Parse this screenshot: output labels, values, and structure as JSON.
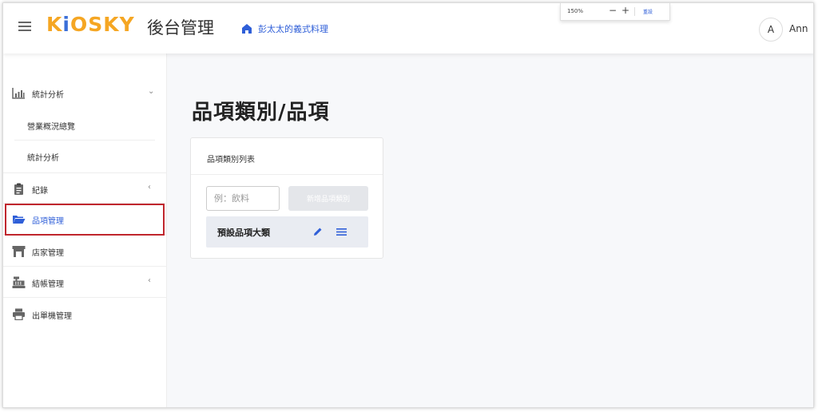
{
  "header": {
    "logo": {
      "part1": "K",
      "dot": "i",
      "part2": "OSKY"
    },
    "title": "後台管理",
    "store_name": "彭太太的義式料理",
    "zoom": {
      "level": "150%",
      "minus": "−",
      "plus": "+",
      "reset": "重設"
    },
    "user": {
      "initial": "A",
      "name": "Ann"
    }
  },
  "sidebar": {
    "items": [
      {
        "label": "統計分析",
        "icon": "bar-chart-icon",
        "chevron": "⌄"
      },
      {
        "label": "營業概況總覽"
      },
      {
        "label": "統計分析"
      },
      {
        "label": "紀錄",
        "icon": "clipboard-icon",
        "chevron": "‹"
      },
      {
        "label": "品項管理",
        "icon": "folder-open-icon"
      },
      {
        "label": "店家管理",
        "icon": "storefront-icon"
      },
      {
        "label": "結帳管理",
        "icon": "cash-register-icon",
        "chevron": "‹"
      },
      {
        "label": "出單機管理",
        "icon": "printer-icon"
      }
    ]
  },
  "main": {
    "page_title": "品項類別/品項",
    "card": {
      "title": "品項類別列表",
      "input_placeholder": "例：飲料",
      "add_button": "新增品項類別",
      "categories": [
        {
          "name": "預設品項大類"
        }
      ]
    }
  },
  "colors": {
    "accent": "#2f5fd8",
    "logo": "#f5a623",
    "highlight": "#c0262d"
  }
}
